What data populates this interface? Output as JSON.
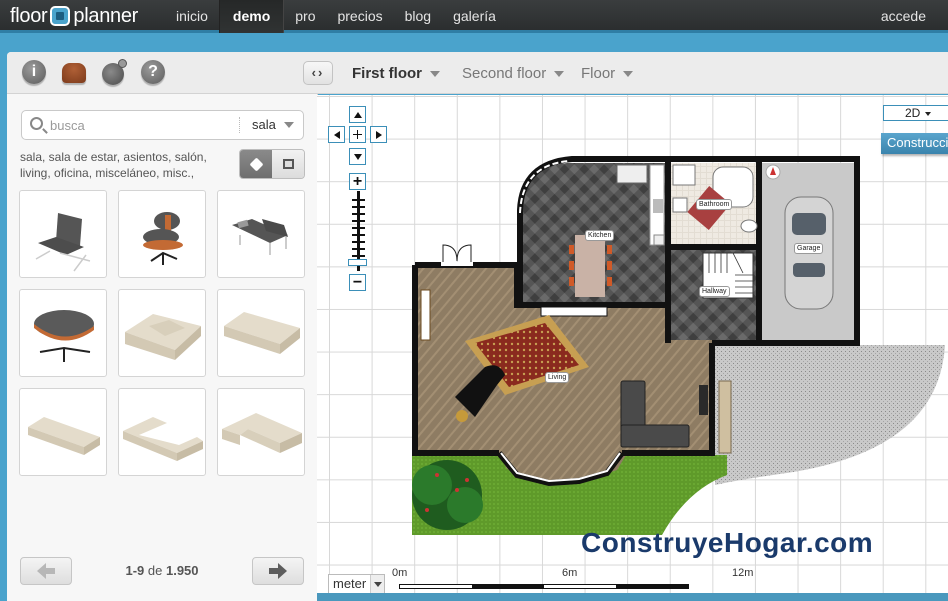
{
  "app": {
    "logo_left": "floor",
    "logo_right": "planner"
  },
  "nav": {
    "items": [
      {
        "label": "inicio",
        "active": false
      },
      {
        "label": "demo",
        "active": true
      },
      {
        "label": "pro",
        "active": false
      },
      {
        "label": "precios",
        "active": false
      },
      {
        "label": "blog",
        "active": false
      },
      {
        "label": "galería",
        "active": false
      }
    ],
    "login": "accede"
  },
  "toolbar": {
    "icons": [
      "info-icon",
      "furniture-icon",
      "globe-icon",
      "help-icon"
    ],
    "info_glyph": "i",
    "help_glyph": "?"
  },
  "library": {
    "search_placeholder": "busca",
    "search_value": "",
    "category": "sala",
    "tags": "sala, sala de estar, asientos, salón, living, oficina, misceláneo, misc.,",
    "view_mode": "3d",
    "items": [
      {
        "name": "barcelona-chair"
      },
      {
        "name": "lounge-chair"
      },
      {
        "name": "daybed-sofa"
      },
      {
        "name": "ottoman"
      },
      {
        "name": "armchair-beige"
      },
      {
        "name": "sofa-beige"
      },
      {
        "name": "long-sofa-beige"
      },
      {
        "name": "corner-sofa-beige"
      },
      {
        "name": "l-sofa-beige"
      }
    ],
    "pagination": {
      "range": "1-9",
      "of": "de",
      "total": "1.950"
    }
  },
  "floors": {
    "tabs": [
      {
        "label": "First floor",
        "active": true
      },
      {
        "label": "Second floor",
        "active": false
      },
      {
        "label": "Floor",
        "active": false
      }
    ]
  },
  "canvas": {
    "view_mode": "2D",
    "construct_label": "Construcción",
    "unit": "meter",
    "scale_labels": [
      "0m",
      "6m",
      "12m"
    ],
    "rooms": [
      "Kitchen",
      "Bathroom",
      "Garage",
      "Hallway",
      "Living"
    ],
    "watermark": "ConstruyeHogar.com"
  },
  "colors": {
    "accent": "#4aa3cc",
    "topbar": "#2f3233",
    "construct_button": "#4a95bf",
    "watermark": "#1a3a6b"
  }
}
